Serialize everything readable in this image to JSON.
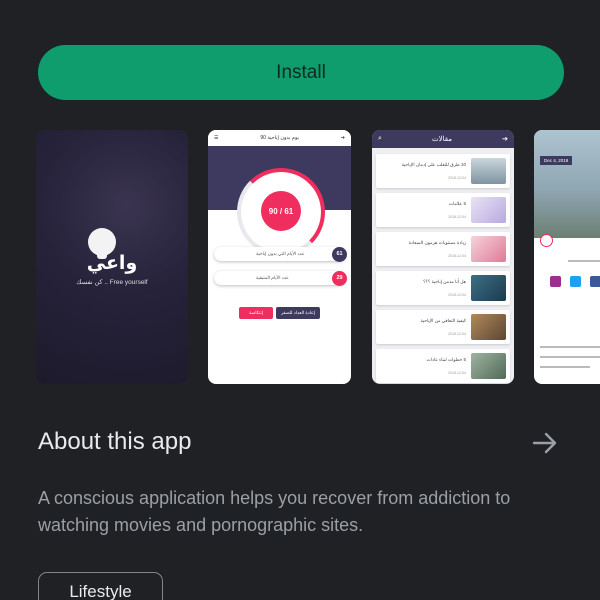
{
  "install": {
    "label": "Install"
  },
  "screenshots": {
    "splash": {
      "logo": "واعي",
      "tagline": "كن نفسك .. Free yourself"
    },
    "counter": {
      "title": "90 يوم بدون إباحية",
      "counter": "90 / 61",
      "rows": [
        {
          "text": "عدد الأيام التي بدون إباحية",
          "value": "61"
        },
        {
          "text": "عدد الأيام المتبقية",
          "value": "29"
        }
      ],
      "buttons": {
        "reset": "إعادة العداد للصفر",
        "relapse": "إنتكاسة"
      }
    },
    "articles": {
      "title": "مقالات",
      "items": [
        {
          "title": "10 طرق للتغلب على إدمان الإباحية",
          "date": "2018-12-04"
        },
        {
          "title": "5 علامات",
          "date": "2018-12-04"
        },
        {
          "title": "زيادة مستويات هرمون السعادة",
          "date": "2018-12-04"
        },
        {
          "title": "هل أنا مدمن إباحية ؟؟؟",
          "date": "2018-12-04"
        },
        {
          "title": "كيفية التعافي من الإباحية",
          "date": "2018-12-04"
        },
        {
          "title": "5 خطوات لبناء عادات",
          "date": "2018-12-04"
        }
      ]
    },
    "detail": {
      "date": "Dec 4, 2018"
    }
  },
  "about": {
    "title": "About this app",
    "description": "A conscious application helps you recover from addiction to watching movies and pornographic sites."
  },
  "category": {
    "label": "Lifestyle"
  },
  "colors": {
    "accent": "#0f9d6e",
    "screenshot_header": "#3e3a5f",
    "screenshot_accent": "#ef2d5e"
  }
}
